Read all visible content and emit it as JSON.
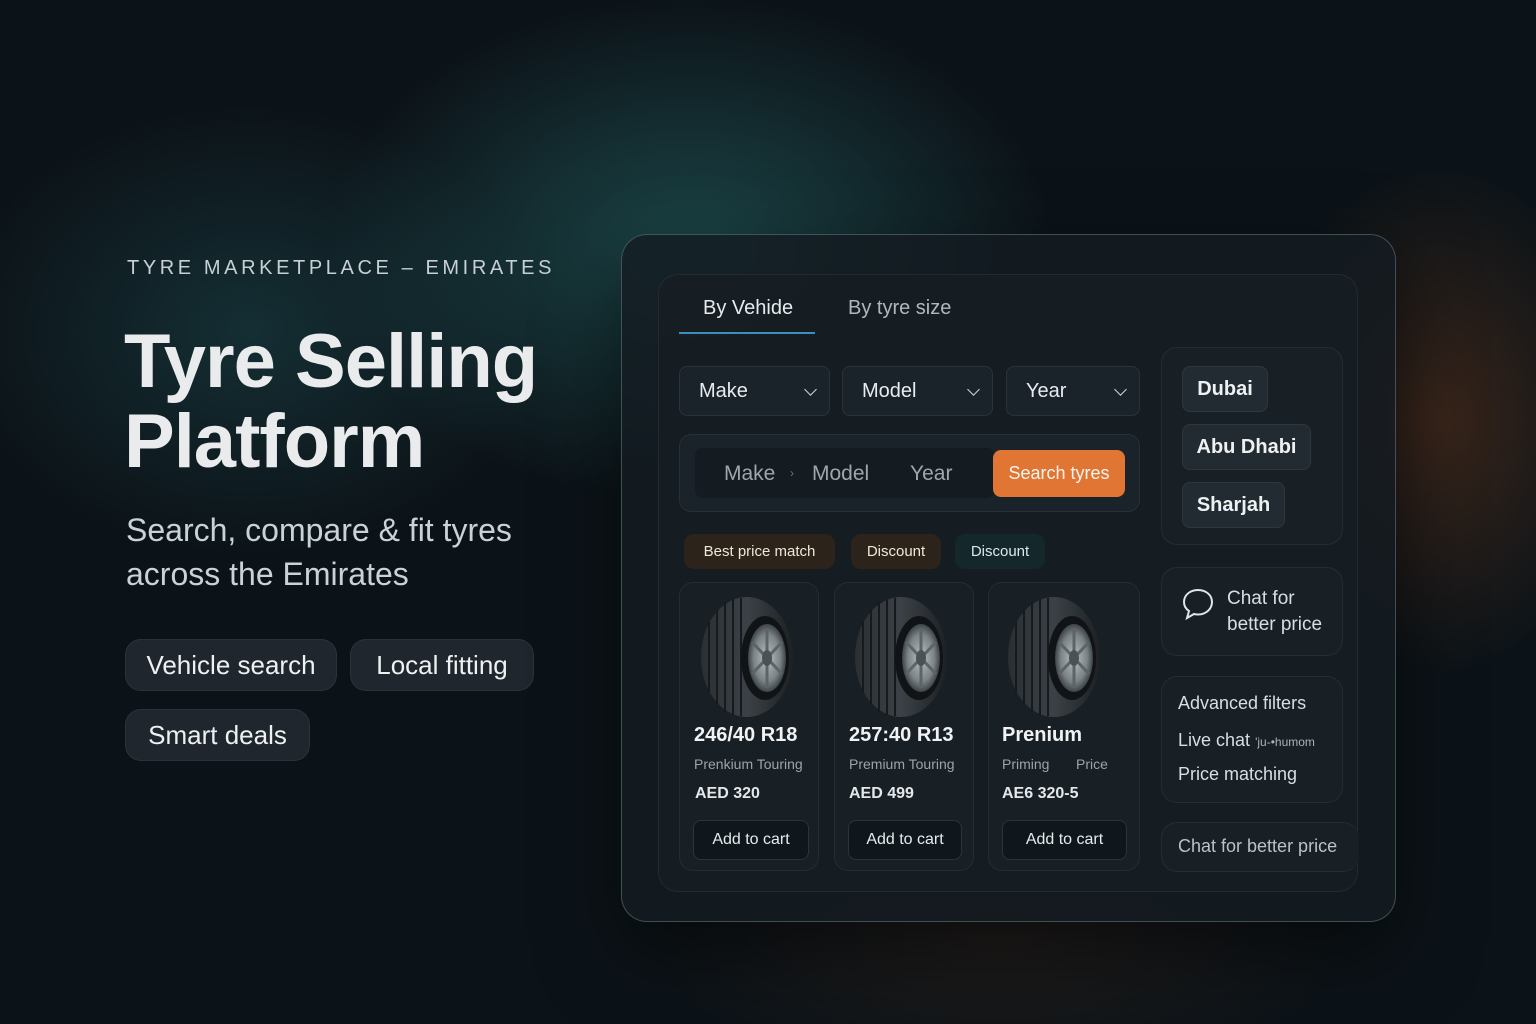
{
  "hero": {
    "eyebrow": "TYRE MARKETPLACE – EMIRATES",
    "title": "Tyre Selling Platform",
    "subtitle": "Search, compare & fit tyres across the Emirates",
    "features": [
      "Vehicle search",
      "Local fitting",
      "Smart deals"
    ]
  },
  "tabs": [
    {
      "label": "By Vehide",
      "active": true
    },
    {
      "label": "By tyre size",
      "active": false
    }
  ],
  "selects": [
    {
      "label": "Make"
    },
    {
      "label": "Model"
    },
    {
      "label": "Year"
    }
  ],
  "search": {
    "make": "Make",
    "separator": "›",
    "model": "Model",
    "year": "Year",
    "button": "Search tyres"
  },
  "badges": [
    "Best price match",
    "Discount",
    "Discount"
  ],
  "products": [
    {
      "size": "246/40 R18",
      "type": "Prenkium Touring",
      "type_extra": "",
      "price": "AED 320",
      "button": "Add to cart"
    },
    {
      "size": "257:40 R13",
      "type": "Premium Touring",
      "type_extra": "",
      "price": "AED 499",
      "button": "Add to cart"
    },
    {
      "size": "Prenium",
      "type": "Priming",
      "type_extra": "Price",
      "price": "AE6 320-5",
      "button": "Add to cart"
    }
  ],
  "locations": [
    "Dubai",
    "Abu Dhabi",
    "Sharjah"
  ],
  "chat_card": {
    "line1": "Chat for",
    "line2": "better price",
    "icon": "chat-bubble-icon"
  },
  "features_list": [
    "Advanced filters",
    "Live chat",
    "Price matching"
  ],
  "live_chat_suffix": "'ju-•humom",
  "chat_footer": "Chat for better price",
  "colors": {
    "accent": "#e07534",
    "tab_underline": "#3a8ec0",
    "background": "#0c1318"
  }
}
